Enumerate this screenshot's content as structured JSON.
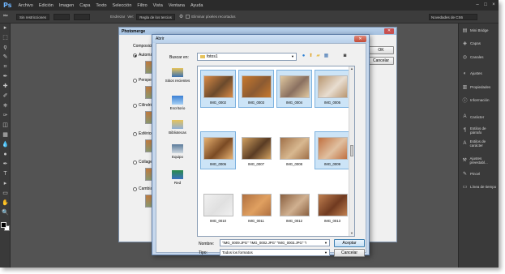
{
  "app": {
    "logo": "Ps",
    "menu": [
      "Archivo",
      "Edición",
      "Imagen",
      "Capa",
      "Texto",
      "Selección",
      "Filtro",
      "Vista",
      "Ventana",
      "Ayuda"
    ],
    "window_controls": [
      "–",
      "□",
      "×"
    ]
  },
  "options_bar": {
    "tool_icon": "crop-tool-icon",
    "style_value": "Sin restricciones",
    "straighten_label": "Endrezar",
    "view_label": "Ver:",
    "view_value": "Regla de los tercios",
    "delete_pixels_label": "Eliminar píxeles recortados",
    "workspace_value": "Novedades de CS6"
  },
  "tools": [
    "move-tool-icon",
    "marquee-tool-icon",
    "lasso-tool-icon",
    "quick-select-tool-icon",
    "crop-tool-icon",
    "eyedropper-tool-icon",
    "healing-brush-icon",
    "brush-tool-icon",
    "clone-stamp-icon",
    "history-brush-icon",
    "eraser-tool-icon",
    "gradient-tool-icon",
    "blur-tool-icon",
    "dodge-tool-icon",
    "pen-tool-icon",
    "type-tool-icon",
    "path-select-icon",
    "shape-tool-icon",
    "hand-tool-icon",
    "zoom-tool-icon"
  ],
  "tool_glyphs": [
    "▸",
    "⬚",
    "ϙ",
    "✎",
    "⌗",
    "✒",
    "✚",
    "✐",
    "⎈",
    "✑",
    "◫",
    "▦",
    "💧",
    "●",
    "✒",
    "T",
    "▸",
    "▭",
    "✋",
    "🔍"
  ],
  "dock": {
    "items": [
      {
        "icon": "mini-bridge-icon",
        "glyph": "▤",
        "label": "Mini Bridge"
      },
      {
        "icon": "layers-icon",
        "glyph": "◈",
        "label": "Capas"
      },
      {
        "icon": "channels-icon",
        "glyph": "◎",
        "label": "Canales"
      },
      {
        "icon": "adjustments-icon",
        "glyph": "◐",
        "label": "Ajustes"
      },
      {
        "icon": "properties-icon",
        "glyph": "▥",
        "label": "Propiedades"
      },
      {
        "icon": "info-icon",
        "glyph": "ⓘ",
        "label": "Información"
      },
      {
        "icon": "character-icon",
        "glyph": "A",
        "label": "Carácter"
      },
      {
        "icon": "paragraph-styles-icon",
        "glyph": "¶",
        "label": "Estilos de párrafo"
      },
      {
        "icon": "character-styles-icon",
        "glyph": "A",
        "label": "Estilos de carácter"
      },
      {
        "icon": "tool-presets-icon",
        "glyph": "⚒",
        "label": "Ajustes preestabl..."
      },
      {
        "icon": "brush-icon",
        "glyph": "✎",
        "label": "Pincel"
      },
      {
        "icon": "timeline-icon",
        "glyph": "▭",
        "label": "Línea de tiempo"
      }
    ]
  },
  "photomerge": {
    "title": "Photomerge",
    "layout_label": "Composición",
    "options": [
      {
        "label": "Automático",
        "selected": true
      },
      {
        "label": "Perspectiva",
        "selected": false
      },
      {
        "label": "Cilíndrico",
        "selected": false
      },
      {
        "label": "Esférico",
        "selected": false
      },
      {
        "label": "Collage",
        "selected": false
      },
      {
        "label": "Cambiar posición",
        "selected": false
      }
    ],
    "ok_label": "OK",
    "cancel_label": "Cancelar"
  },
  "open_dialog": {
    "title": "Abrir",
    "look_in_label": "Buscar en:",
    "look_in_value": "fotos1",
    "places": [
      {
        "icon": "recent-places-icon",
        "label": "Sitios recientes"
      },
      {
        "icon": "desktop-icon",
        "label": "Escritorio"
      },
      {
        "icon": "libraries-icon",
        "label": "Bibliotecas"
      },
      {
        "icon": "computer-icon",
        "label": "Equipo"
      },
      {
        "icon": "network-icon",
        "label": "Red"
      }
    ],
    "files": [
      {
        "name": "IMG_0002",
        "selected": true,
        "c1": "#d88a46",
        "c2": "#6b4a2c"
      },
      {
        "name": "IMG_0003",
        "selected": true,
        "c1": "#c7792e",
        "c2": "#8b5a32"
      },
      {
        "name": "IMG_0004",
        "selected": true,
        "c1": "#e0c8a0",
        "c2": "#8a7060"
      },
      {
        "name": "IMG_0005",
        "selected": true,
        "c1": "#b89670",
        "c2": "#e8ddd0"
      },
      {
        "name": "IMG_0006",
        "selected": true,
        "c1": "#e6b070",
        "c2": "#7a4a24"
      },
      {
        "name": "IMG_0007",
        "selected": false,
        "c1": "#d0a060",
        "c2": "#5a3c24"
      },
      {
        "name": "IMG_0008",
        "selected": false,
        "c1": "#a07048",
        "c2": "#d8b890"
      },
      {
        "name": "IMG_0009",
        "selected": true,
        "c1": "#c07040",
        "c2": "#e0c0a0"
      },
      {
        "name": "IMG_0010",
        "selected": false,
        "c1": "#f0f0f0",
        "c2": "#e0e0e0"
      },
      {
        "name": "IMG_0011",
        "selected": false,
        "c1": "#b07040",
        "c2": "#e0a060"
      },
      {
        "name": "IMG_0012",
        "selected": false,
        "c1": "#8a6040",
        "c2": "#d0b090"
      },
      {
        "name": "IMG_0013",
        "selected": false,
        "c1": "#c08050",
        "c2": "#703a20"
      }
    ],
    "name_label": "Nombre:",
    "name_value": "\"IMG_0009.JPG\" \"IMG_0002.JPG\" \"IMG_0003.JPG\" \"I",
    "type_label": "Tipo:",
    "type_value": "Todos los formatos",
    "accept_label": "Aceptar",
    "cancel_label": "Cancelar"
  }
}
